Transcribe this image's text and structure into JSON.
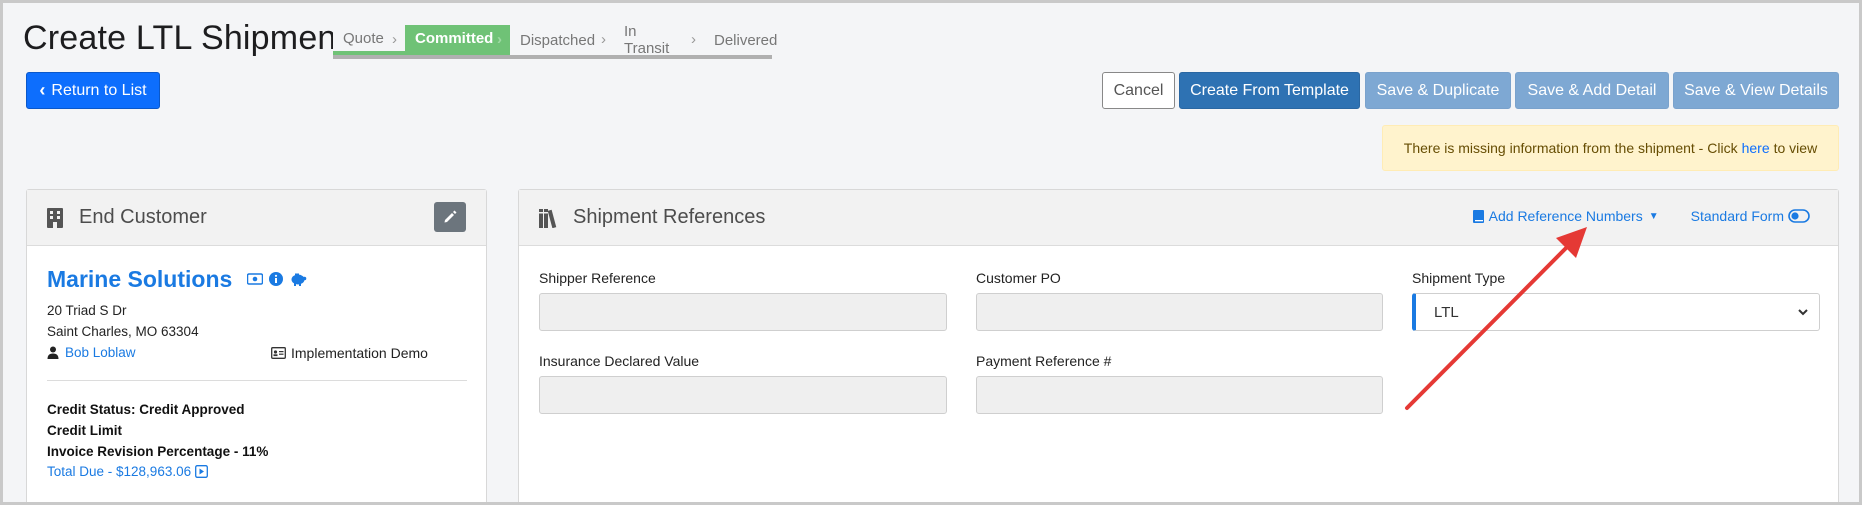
{
  "header": {
    "title": "Create LTL Shipment",
    "steps": [
      {
        "label": "Quote",
        "state": "done"
      },
      {
        "label": "Committed",
        "state": "active"
      },
      {
        "label": "Dispatched",
        "state": "pending"
      },
      {
        "label": "In Transit",
        "state": "pending"
      },
      {
        "label": "Delivered",
        "state": "pending"
      }
    ]
  },
  "toolbar": {
    "return_label": "Return to List",
    "cancel_label": "Cancel",
    "template_label": "Create From Template",
    "save_duplicate_label": "Save & Duplicate",
    "save_add_detail_label": "Save & Add Detail",
    "save_view_label": "Save & View Details"
  },
  "alert": {
    "prefix": "There is missing information from the shipment - Click",
    "link": "here",
    "suffix": "to view"
  },
  "end_customer": {
    "title": "End Customer",
    "name": "Marine Solutions",
    "address_line1": "20 Triad S Dr",
    "address_line2": "Saint Charles, MO 63304",
    "contact": "Bob Loblaw",
    "account": "Implementation Demo",
    "credit_status": "Credit Status: Credit Approved",
    "credit_limit": "Credit Limit",
    "invoice_revision": "Invoice Revision Percentage - 11%",
    "total_due": "Total Due - $128,963.06"
  },
  "references": {
    "title": "Shipment References",
    "add_reference_label": "Add Reference Numbers",
    "standard_form_label": "Standard Form",
    "fields": {
      "shipper_reference_label": "Shipper Reference",
      "customer_po_label": "Customer PO",
      "shipment_type_label": "Shipment Type",
      "shipment_type_value": "LTL",
      "insurance_label": "Insurance Declared Value",
      "payment_reference_label": "Payment Reference #"
    }
  },
  "colors": {
    "primary": "#0d6efd",
    "committed_step": "#6fc276",
    "muted_button": "#7ea8d3",
    "annotation_arrow": "#e53935"
  }
}
